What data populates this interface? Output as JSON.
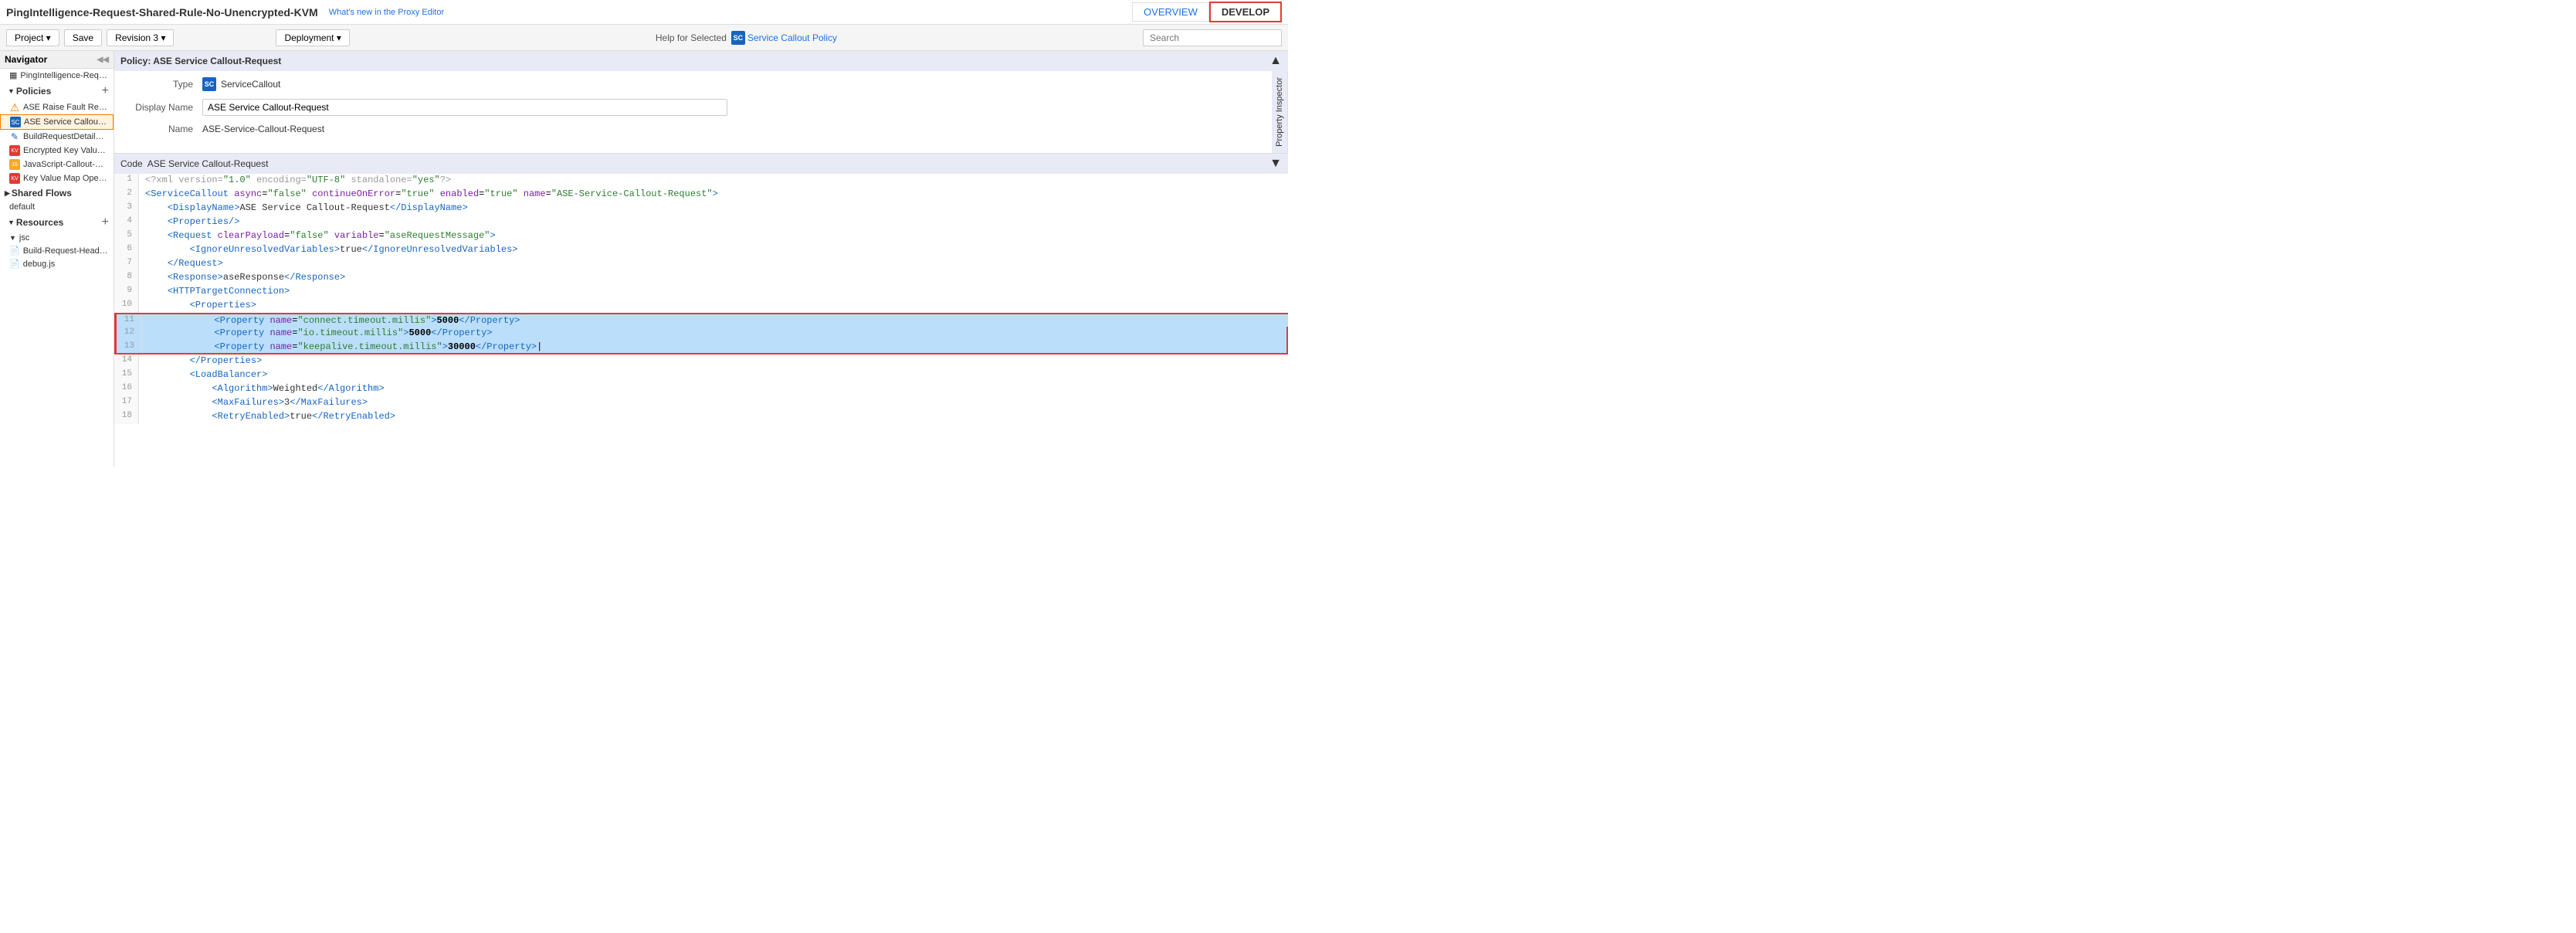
{
  "app": {
    "title": "PingIntelligence-Request-Shared-Rule-No-Unencrypted-KVM",
    "whats_new": "What's new in the Proxy Editor",
    "tab_overview": "OVERVIEW",
    "tab_develop": "DEVELOP"
  },
  "toolbar": {
    "project_btn": "Project ▾",
    "save_btn": "Save",
    "revision_btn": "Revision 3 ▾",
    "deployment_btn": "Deployment ▾",
    "help_label": "Help for Selected",
    "service_callout_link": "Service Callout Policy",
    "search_placeholder": "Search"
  },
  "navigator": {
    "title": "Navigator",
    "proxy_name": "PingIntelligence-Request-SharedRule",
    "policies_label": "Policies",
    "policy_items": [
      {
        "name": "ASE Raise Fault Request",
        "icon": "fault",
        "active": false
      },
      {
        "name": "ASE Service Callout-Request",
        "icon": "sc",
        "active": true
      },
      {
        "name": "BuildRequestDetailMessage-Ass...",
        "icon": "assign",
        "active": false
      },
      {
        "name": "Encrypted Key Value Map Opera...",
        "icon": "kv",
        "active": false
      },
      {
        "name": "JavaScript-Callout-Build-Header...",
        "icon": "js",
        "active": false
      },
      {
        "name": "Key Value Map Operations Requ...",
        "icon": "kv",
        "active": false
      }
    ],
    "shared_flows_label": "Shared Flows",
    "default_label": "default",
    "resources_label": "Resources",
    "jsc_label": "jsc",
    "resource_items": [
      {
        "name": "Build-Request-Headers.js",
        "icon": "file"
      },
      {
        "name": "debug.js",
        "icon": "file"
      }
    ]
  },
  "policy_panel": {
    "header": "Policy: ASE Service Callout-Request",
    "type_label": "Type",
    "type_value": "ServiceCallout",
    "display_name_label": "Display Name",
    "display_name_value": "ASE Service Callout-Request",
    "name_label": "Name",
    "name_value": "ASE-Service-Callout-Request",
    "property_inspector": "Property Inspector"
  },
  "code_panel": {
    "header_code": "Code",
    "header_filename": "ASE Service Callout-Request",
    "lines": [
      {
        "num": 1,
        "content": "<?xml version=\"1.0\" encoding=\"UTF-8\" standalone=\"yes\"?>",
        "highlight": false
      },
      {
        "num": 2,
        "content": "<ServiceCallout async=\"false\" continueOnError=\"true\" enabled=\"true\" name=\"ASE-Service-Callout-Request\">",
        "highlight": false
      },
      {
        "num": 3,
        "content": "    <DisplayName>ASE Service Callout-Request</DisplayName>",
        "highlight": false
      },
      {
        "num": 4,
        "content": "    <Properties/>",
        "highlight": false
      },
      {
        "num": 5,
        "content": "    <Request clearPayload=\"false\" variable=\"aseRequestMessage\">",
        "highlight": false
      },
      {
        "num": 6,
        "content": "        <IgnoreUnresolvedVariables>true</IgnoreUnresolvedVariables>",
        "highlight": false
      },
      {
        "num": 7,
        "content": "    </Request>",
        "highlight": false
      },
      {
        "num": 8,
        "content": "    <Response>aseResponse</Response>",
        "highlight": false
      },
      {
        "num": 9,
        "content": "    <HTTPTargetConnection>",
        "highlight": false
      },
      {
        "num": 10,
        "content": "        <Properties>",
        "highlight": false
      },
      {
        "num": 11,
        "content": "            <Property name=\"connect.timeout.millis\">5000</Property>",
        "highlight": true
      },
      {
        "num": 12,
        "content": "            <Property name=\"io.timeout.millis\">5000</Property>",
        "highlight": true
      },
      {
        "num": 13,
        "content": "            <Property name=\"keepalive.timeout.millis\">30000</Property>",
        "highlight": true
      },
      {
        "num": 14,
        "content": "        </Properties>",
        "highlight": false
      },
      {
        "num": 15,
        "content": "        <LoadBalancer>",
        "highlight": false
      },
      {
        "num": 16,
        "content": "            <Algorithm>Weighted</Algorithm>",
        "highlight": false
      },
      {
        "num": 17,
        "content": "            <MaxFailures>3</MaxFailures>",
        "highlight": false
      },
      {
        "num": 18,
        "content": "            <RetryEnabled>true</RetryEnabled>",
        "highlight": false
      }
    ]
  }
}
